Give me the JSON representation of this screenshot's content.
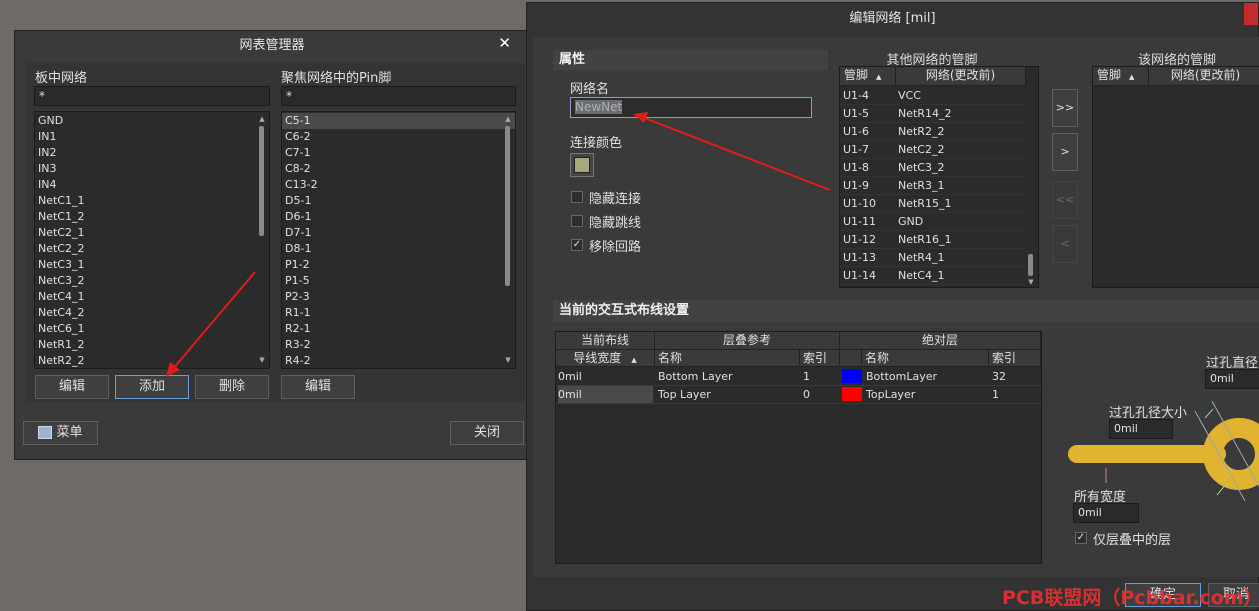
{
  "netlist_manager": {
    "title": "网表管理器",
    "board_nets_label": "板中网络",
    "board_nets_filter": "*",
    "board_nets": [
      "GND",
      "IN1",
      "IN2",
      "IN3",
      "IN4",
      "NetC1_1",
      "NetC1_2",
      "NetC2_1",
      "NetC2_2",
      "NetC3_1",
      "NetC3_2",
      "NetC4_1",
      "NetC4_2",
      "NetC6_1",
      "NetR1_2",
      "NetR2_2"
    ],
    "pins_label": "聚焦网络中的Pin脚",
    "pins_filter": "*",
    "pins": [
      "C5-1",
      "C6-2",
      "C7-1",
      "C8-2",
      "C13-2",
      "D5-1",
      "D6-1",
      "D7-1",
      "D8-1",
      "P1-2",
      "P1-5",
      "P2-3",
      "R1-1",
      "R2-1",
      "R3-2",
      "R4-2"
    ],
    "edit_label": "编辑",
    "add_label": "添加",
    "delete_label": "删除",
    "pin_edit_label": "编辑",
    "menu_label": "菜单",
    "close_label": "关闭"
  },
  "edit_net": {
    "title": "编辑网络 [mil]",
    "properties_header": "属性",
    "net_name_label": "网络名",
    "net_name_value": "NewNet",
    "connection_color_label": "连接颜色",
    "connection_color": "#a8a87a",
    "hide_connection_label": "隐藏连接",
    "hide_jumper_label": "隐藏跳线",
    "remove_loop_label": "移除回路",
    "remove_loop_checked": "✓",
    "other_pins_title": "其他网络的管脚",
    "col_pin": "管脚",
    "col_net_before": "网络(更改前)",
    "other_pins": [
      {
        "pin": "U1-4",
        "net": "VCC"
      },
      {
        "pin": "U1-5",
        "net": "NetR14_2"
      },
      {
        "pin": "U1-6",
        "net": "NetR2_2"
      },
      {
        "pin": "U1-7",
        "net": "NetC2_2"
      },
      {
        "pin": "U1-8",
        "net": "NetC3_2"
      },
      {
        "pin": "U1-9",
        "net": "NetR3_1"
      },
      {
        "pin": "U1-10",
        "net": "NetR15_1"
      },
      {
        "pin": "U1-11",
        "net": "GND"
      },
      {
        "pin": "U1-12",
        "net": "NetR16_1"
      },
      {
        "pin": "U1-13",
        "net": "NetR4_1"
      },
      {
        "pin": "U1-14",
        "net": "NetC4_1"
      }
    ],
    "this_pins_title": "该网络的管脚",
    "move_all_right": ">>",
    "move_right": ">",
    "move_all_left": "<<",
    "move_left": "<",
    "routing_header": "当前的交互式布线设置",
    "col_current_routing": "当前布线",
    "col_layer_stack_ref": "层叠参考",
    "col_absolute_layer": "绝对层",
    "col_trace_width": "导线宽度",
    "col_name": "名称",
    "col_index": "索引",
    "col_name2": "名称",
    "col_index2": "索引",
    "routing_rows": [
      {
        "width": "0mil",
        "layer": "Bottom Layer",
        "index": "1",
        "color": "#0000ff",
        "abs_name": "BottomLayer",
        "abs_index": "32"
      },
      {
        "width": "0mil",
        "layer": "Top Layer",
        "index": "0",
        "color": "#ff0000",
        "abs_name": "TopLayer",
        "abs_index": "1"
      }
    ],
    "via_diameter_label": "过孔直径",
    "via_diameter_value": "0mil",
    "via_hole_label": "过孔孔径大小",
    "via_hole_value": "0mil",
    "all_width_label": "所有宽度",
    "all_width_value": "0mil",
    "stack_layers_only_label": "仅层叠中的层",
    "stack_layers_only_checked": "✓",
    "ok_label": "确定",
    "cancel_label": "取消",
    "watermark": "PCB联盟网（Pcbbar.com）",
    "via_color": "#e0b330"
  }
}
